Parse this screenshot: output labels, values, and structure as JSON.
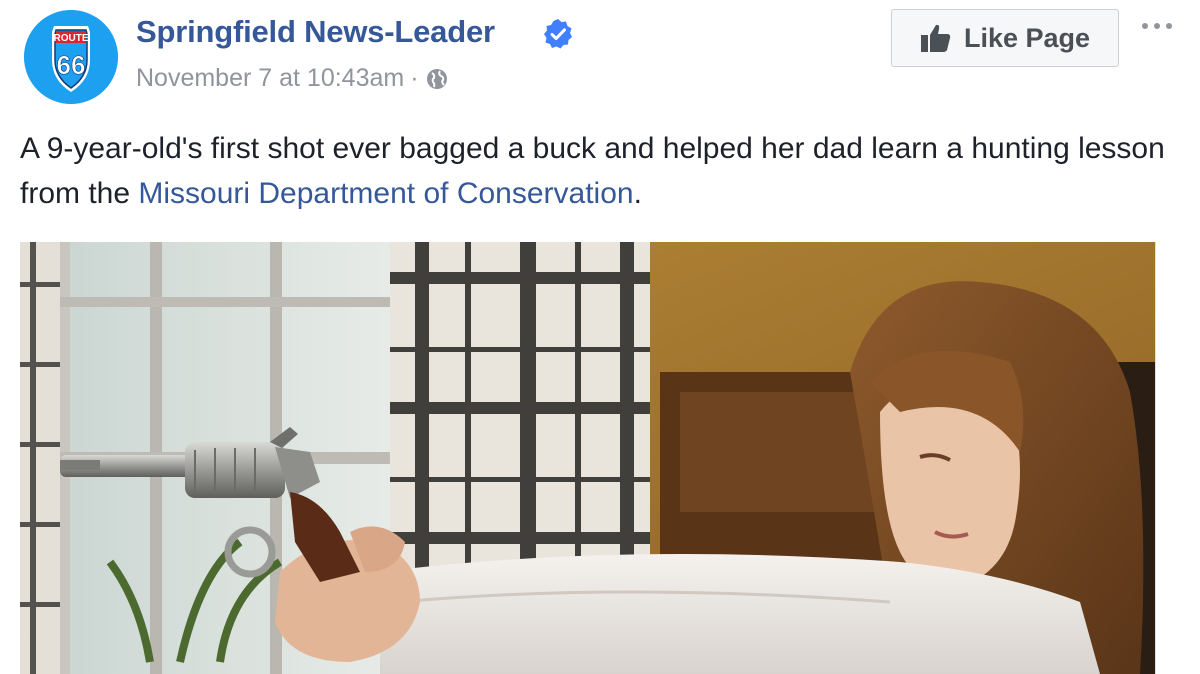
{
  "header": {
    "page_name": "Springfield News-Leader",
    "verified_icon": "verified-badge-icon",
    "timestamp": "November 7 at 10:43am",
    "separator": "·",
    "audience_icon": "globe-icon",
    "avatar": {
      "sign_text_top": "ROUTE",
      "sign_text_number": "66",
      "background_color": "#1ea0f0"
    }
  },
  "actions": {
    "like_page_label": "Like Page",
    "like_icon": "thumbs-up-icon",
    "more_icon": "more-options-icon"
  },
  "post": {
    "text_before_link": "A 9-year-old's first shot ever bagged a buck and helped her dad learn a hunting lesson from the ",
    "link_text": "Missouri Department of Conservation",
    "text_after_link": ".",
    "link_color": "#365899"
  },
  "photo": {
    "subject": "photo-girl-aiming-revolver"
  },
  "colors": {
    "page_name": "#365899",
    "meta_text": "#90949c",
    "body_text": "#1d2129",
    "button_bg": "#f6f7f9",
    "button_border": "#ced0d4",
    "verified_badge": "#4080ff"
  }
}
